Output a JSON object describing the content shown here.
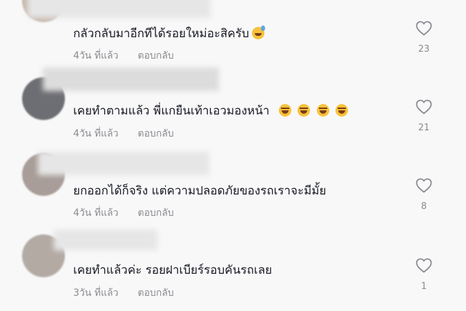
{
  "comments": [
    {
      "text": "กลัวกลับมาอีกทีได้รอยใหม่อะสิครับ",
      "emojis": [
        "sweat"
      ],
      "time": "4วัน ที่แล้ว",
      "reply": "ตอบกลับ",
      "likes": "23"
    },
    {
      "text": "เคยทำตามแล้ว พี่แกยืนเท้าเอวมองหน้า",
      "emojis": [
        "laugh",
        "laugh",
        "laugh",
        "laugh"
      ],
      "time": "4วัน ที่แล้ว",
      "reply": "ตอบกลับ",
      "likes": "21"
    },
    {
      "text": "ยกออกได้ก็จริง แต่ความปลอดภัยของรถเราจะมีมั้ย",
      "emojis": [],
      "time": "4วัน ที่แล้ว",
      "reply": "ตอบกลับ",
      "likes": "8"
    },
    {
      "text": "เคยทำแล้วค่ะ รอยฝาเบียร์รอบคันรถเลย",
      "emojis": [],
      "time": "3วัน ที่แล้ว",
      "reply": "ตอบกลับ",
      "likes": "1"
    }
  ],
  "icons": {
    "like": "heart-outline-icon"
  },
  "colors": {
    "text": "#161823",
    "meta": "#8a8b91",
    "background": "#f8f8f8"
  }
}
